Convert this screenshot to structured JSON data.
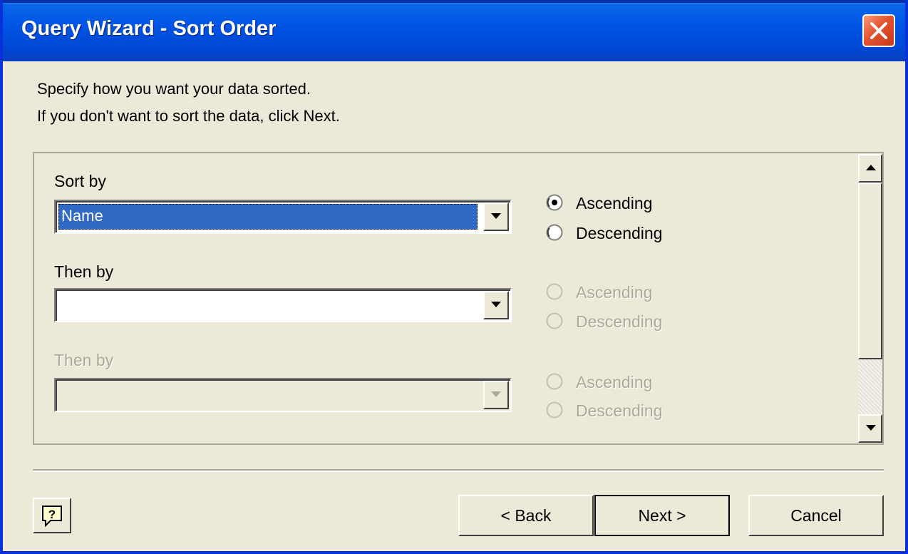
{
  "window": {
    "title": "Query Wizard - Sort Order"
  },
  "instructions": {
    "line1": "Specify how you want your data sorted.",
    "line2": "If you don't want to sort the data, click Next."
  },
  "sort_groups": [
    {
      "label": "Sort by",
      "value": "Name",
      "enabled": true,
      "ascending_label": "Ascending",
      "descending_label": "Descending",
      "selected_order": "Ascending"
    },
    {
      "label": "Then by",
      "value": "",
      "enabled": true,
      "ascending_label": "Ascending",
      "descending_label": "Descending",
      "selected_order": null
    },
    {
      "label": "Then by",
      "value": "",
      "enabled": false,
      "ascending_label": "Ascending",
      "descending_label": "Descending",
      "selected_order": null
    }
  ],
  "buttons": {
    "back": "< Back",
    "next": "Next >",
    "cancel": "Cancel",
    "help_icon": "help-icon"
  },
  "colors": {
    "title_bar": "#0055e5",
    "close_button": "#e4532f",
    "selection": "#316ac5",
    "dialog_bg": "#ece9d8",
    "disabled_text": "#aca899"
  }
}
